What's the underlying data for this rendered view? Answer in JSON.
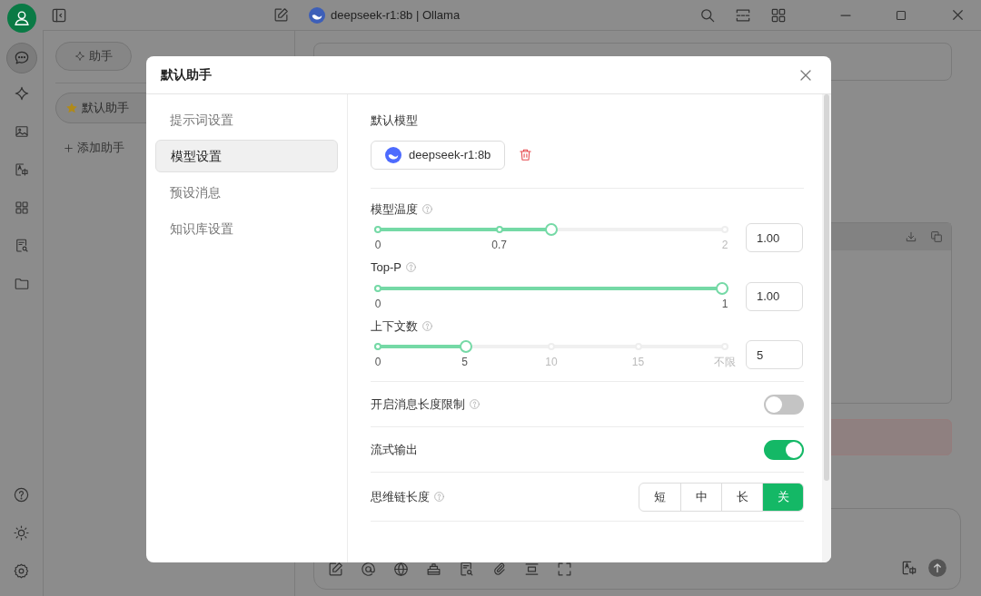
{
  "title_bar": {
    "title": "deepseek-r1:8b | Ollama"
  },
  "assistant_panel": {
    "tabs": [
      {
        "label": "助手",
        "selected": true
      }
    ],
    "assistants": [
      {
        "name": "默认助手",
        "selected": true
      }
    ],
    "add_label": "添加助手"
  },
  "dialog": {
    "title": "默认助手",
    "nav": [
      {
        "label": "提示词设置",
        "selected": false
      },
      {
        "label": "模型设置",
        "selected": true
      },
      {
        "label": "预设消息",
        "selected": false
      },
      {
        "label": "知识库设置",
        "selected": false
      }
    ],
    "model_label": "默认模型",
    "model_name": "deepseek-r1:8b",
    "sliders": [
      {
        "label": "模型温度",
        "help": true,
        "level": 0.5,
        "value": "1.00",
        "marks": [
          {
            "label": "0",
            "level": 0
          },
          {
            "label": "0.7",
            "level": 0.35
          },
          {
            "label": "2",
            "level": 1
          }
        ]
      },
      {
        "label": "Top-P",
        "help": true,
        "level": 1,
        "value": "1.00",
        "marks": [
          {
            "label": "0",
            "level": 0
          },
          {
            "label": "1",
            "level": 1
          }
        ]
      },
      {
        "label": "上下文数",
        "help": true,
        "level": 0.25,
        "value": "5",
        "marks": [
          {
            "label": "0",
            "level": 0
          },
          {
            "label": "5",
            "level": 0.25
          },
          {
            "label": "10",
            "level": 0.5
          },
          {
            "label": "15",
            "level": 0.75
          },
          {
            "label": "不限",
            "level": 1
          }
        ]
      }
    ],
    "toggles": [
      {
        "label": "开启消息长度限制",
        "help": true,
        "on": false
      },
      {
        "label": "流式输出",
        "help": false,
        "on": true
      }
    ],
    "segmented": {
      "label": "思维链长度",
      "help": true,
      "options": [
        {
          "label": "短",
          "selected": false
        },
        {
          "label": "中",
          "selected": false
        },
        {
          "label": "长",
          "selected": false
        },
        {
          "label": "关",
          "selected": true
        }
      ]
    }
  }
}
